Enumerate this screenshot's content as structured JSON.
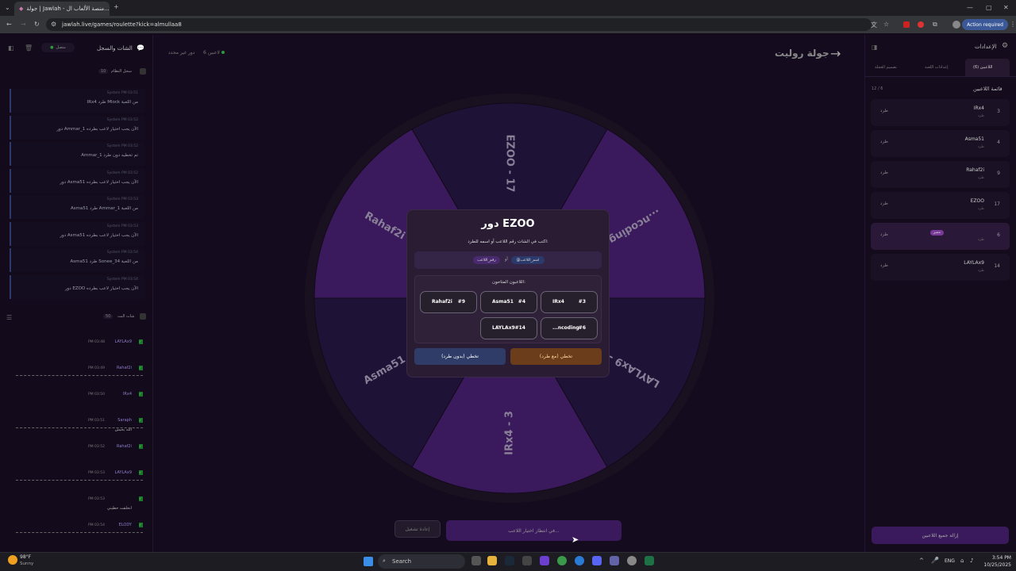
{
  "browser": {
    "tab_title": "جولة | Jawlah - منصة الألعاب ال...",
    "url": "jawlah.live/games/roulette?kick=almullaa8",
    "action_required": "Action required"
  },
  "header": {
    "title": "جولة روليت",
    "players_count": "6 لاعبين",
    "rounds": "دور غير محدد"
  },
  "left_panel": {
    "title": "الشات والسجل",
    "status": "متصل",
    "log_title": "سجل النظام",
    "log_count": "10",
    "log_items": [
      {
        "meta": "System  PM 03:51",
        "text": "IRx4 طرد Mlock من اللعبة"
      },
      {
        "meta": "System  PM 03:52",
        "text": "دور Ammar_1 الآن يجب اختيار لاعب بطرده"
      },
      {
        "meta": "System  PM 03:52",
        "text": "Ammar_1 تم تخطيه دون طرد"
      },
      {
        "meta": "System  PM 03:52",
        "text": "دور Asma51 الآن يجب اختيار لاعب بطرده"
      },
      {
        "meta": "System  PM 03:53",
        "text": "Asma51 طرد Ammar_1 من اللعبة"
      },
      {
        "meta": "System  PM 03:53",
        "text": "دور Asma51 الآن يجب اختيار لاعب بطرده"
      },
      {
        "meta": "System  PM 03:54",
        "text": "Asma51 طرد Sonee_34 من اللعبة"
      },
      {
        "meta": "System  PM 03:54",
        "text": "دور EZOO الآن يجب اختيار لاعب بطرده"
      }
    ],
    "chat_title": "شات البث",
    "chat_count": "50",
    "chat_items": [
      {
        "time": "PM 03:48",
        "name": "LAYLAx9",
        "text": ""
      },
      {
        "time": "PM 03:49",
        "name": "Rahaf2i",
        "text": ""
      },
      {
        "time": "PM 03:50",
        "name": "IRx4",
        "text": ""
      },
      {
        "time": "PM 03:51",
        "name": "Saraph",
        "text": "الله يحيش"
      },
      {
        "time": "PM 03:52",
        "name": "Rahaf2i",
        "text": ""
      },
      {
        "time": "PM 03:53",
        "name": "LAYLAx9",
        "text": ""
      },
      {
        "time": "PM 03:53",
        "name": "",
        "text": "انخلقت حطيني"
      },
      {
        "time": "PM 03:54",
        "name": "ELODY",
        "text": ""
      }
    ]
  },
  "right_panel": {
    "title": "الإعدادات",
    "tabs": [
      "اللاعبين (6)",
      "إعدادات اللعبة",
      "تصميم العجلة"
    ],
    "list_title": "قائمة اللاعبين",
    "list_count": "12 / 6",
    "players": [
      {
        "name": "IRx4",
        "sub": "طرد",
        "num": "3",
        "kick": "طرد"
      },
      {
        "name": "Asma51",
        "sub": "طرد",
        "num": "4",
        "kick": "طرد"
      },
      {
        "name": "Rahaf2i",
        "sub": "طرد",
        "num": "9",
        "kick": "طرد"
      },
      {
        "name": "EZOO",
        "sub": "طرد",
        "num": "17",
        "kick": "طرد"
      },
      {
        "name": "",
        "sub": "طرد",
        "num": "6",
        "kick": "طرد",
        "badge": "مميز"
      },
      {
        "name": "LAYLAx9",
        "sub": "طرد",
        "num": "14",
        "kick": "طرد"
      }
    ],
    "remove_all": "إزالة جميع اللاعبين"
  },
  "wheel": {
    "segments": [
      {
        "label": "EZOO - 17",
        "color": "#1e1236"
      },
      {
        "label": "...ncoding - 6",
        "color": "#3a1a5c"
      },
      {
        "label": "LAYLAx9 - 14",
        "color": "#1e1236"
      },
      {
        "label": "IRx4 - 3",
        "color": "#3a1a5c"
      },
      {
        "label": "Asma51 - 4",
        "color": "#1e1236"
      },
      {
        "label": "Rahaf2i - 9",
        "color": "#3a1a5c"
      }
    ]
  },
  "modal": {
    "title": "دور EZOO",
    "subtitle": "اكتب في الشات رقم اللاعب أو اسمه للطرد:",
    "tag_name": "@اسم_اللاعب",
    "tag_or": "أو",
    "tag_number": "رقم_اللاعب",
    "available_title": "اللاعبون المتاحون:",
    "players": [
      {
        "name": "IRx4",
        "num": "#3"
      },
      {
        "name": "Asma51",
        "num": "#4"
      },
      {
        "name": "Rahaf2i",
        "num": "#9"
      },
      {
        "name": "...ncoding",
        "num": "#6"
      },
      {
        "name": "LAYLAx9",
        "num": "#14"
      }
    ],
    "skip_kick": "تخطي (مع طرد)",
    "skip_nokick": "تخطي (بدون طرد)"
  },
  "bottom": {
    "waiting": "في انتظار اختيار اللاعب...",
    "restart": "إعادة تشغيل"
  },
  "taskbar": {
    "weather_temp": "98°F",
    "weather_desc": "Sunny",
    "search": "Search",
    "lang": "ENG",
    "time": "3:54 PM",
    "date": "10/25/2025"
  }
}
